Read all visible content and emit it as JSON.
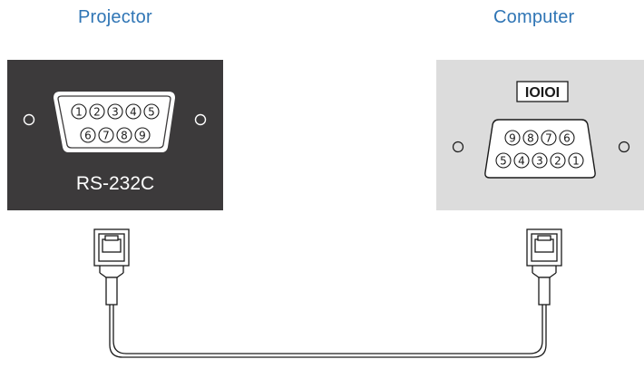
{
  "labels": {
    "projector": "Projector",
    "computer": "Computer"
  },
  "projector_port": {
    "name": "RS-232C",
    "pins_top": [
      "1",
      "2",
      "3",
      "4",
      "5"
    ],
    "pins_bottom": [
      "6",
      "7",
      "8",
      "9"
    ]
  },
  "computer_port": {
    "symbol": "IOIOI",
    "pins_top": [
      "9",
      "8",
      "7",
      "6"
    ],
    "pins_bottom": [
      "5",
      "4",
      "3",
      "2",
      "1"
    ]
  },
  "colors": {
    "title_blue": "#2f75b5",
    "projector_panel": "#3c3a3b",
    "computer_panel": "#dcdcdc",
    "line": "#1a1a1a"
  },
  "icons": {
    "cable": "serial-cable",
    "connector": "db9-plug-icon",
    "serial_symbol": "serial-port-symbol"
  }
}
